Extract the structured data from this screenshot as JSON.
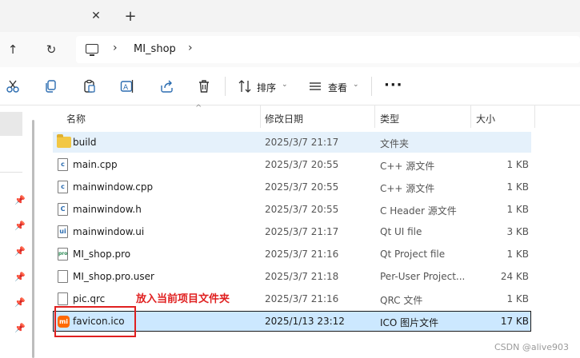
{
  "tabbar": {
    "close_glyph": "✕",
    "new_tab_glyph": "+"
  },
  "nav": {
    "up_glyph": "↑",
    "refresh_glyph": "↻"
  },
  "address": {
    "sep1": "›",
    "crumb": "MI_shop",
    "sep2": "›"
  },
  "toolbar": {
    "sort_label": "排序",
    "view_label": "查看",
    "more_label": "···",
    "chevron": "⌄"
  },
  "columns": {
    "name": "名称",
    "date": "修改日期",
    "type": "类型",
    "size": "大小",
    "sort_caret": "^"
  },
  "files": [
    {
      "icon": "folder",
      "name": "build",
      "date": "2025/3/7 21:17",
      "type": "文件夹",
      "size": ""
    },
    {
      "icon": "c",
      "name": "main.cpp",
      "date": "2025/3/7 20:55",
      "type": "C++ 源文件",
      "size": "1 KB"
    },
    {
      "icon": "c",
      "name": "mainwindow.cpp",
      "date": "2025/3/7 20:55",
      "type": "C++ 源文件",
      "size": "1 KB"
    },
    {
      "icon": "C",
      "name": "mainwindow.h",
      "date": "2025/3/7 20:55",
      "type": "C Header 源文件",
      "size": "1 KB"
    },
    {
      "icon": "ui",
      "name": "mainwindow.ui",
      "date": "2025/3/7 21:17",
      "type": "Qt UI file",
      "size": "3 KB"
    },
    {
      "icon": "pro",
      "name": "MI_shop.pro",
      "date": "2025/3/7 21:16",
      "type": "Qt Project file",
      "size": "1 KB"
    },
    {
      "icon": "",
      "name": "MI_shop.pro.user",
      "date": "2025/3/7 21:18",
      "type": "Per-User Project...",
      "size": "24 KB"
    },
    {
      "icon": "",
      "name": "pic.qrc",
      "date": "2025/3/7 21:16",
      "type": "QRC 文件",
      "size": "1 KB"
    },
    {
      "icon": "mi",
      "name": "favicon.ico",
      "date": "2025/1/13 23:12",
      "type": "ICO 图片文件",
      "size": "17 KB"
    }
  ],
  "annotation": {
    "text": "放入当前项目文件夹",
    "color": "#e02020"
  },
  "watermark": "CSDN @alive903",
  "colors": {
    "selected_row": "#cce8ff",
    "hover_row": "#e5f1fb",
    "folder": "#f2c744",
    "mi_brand": "#ff6900"
  }
}
